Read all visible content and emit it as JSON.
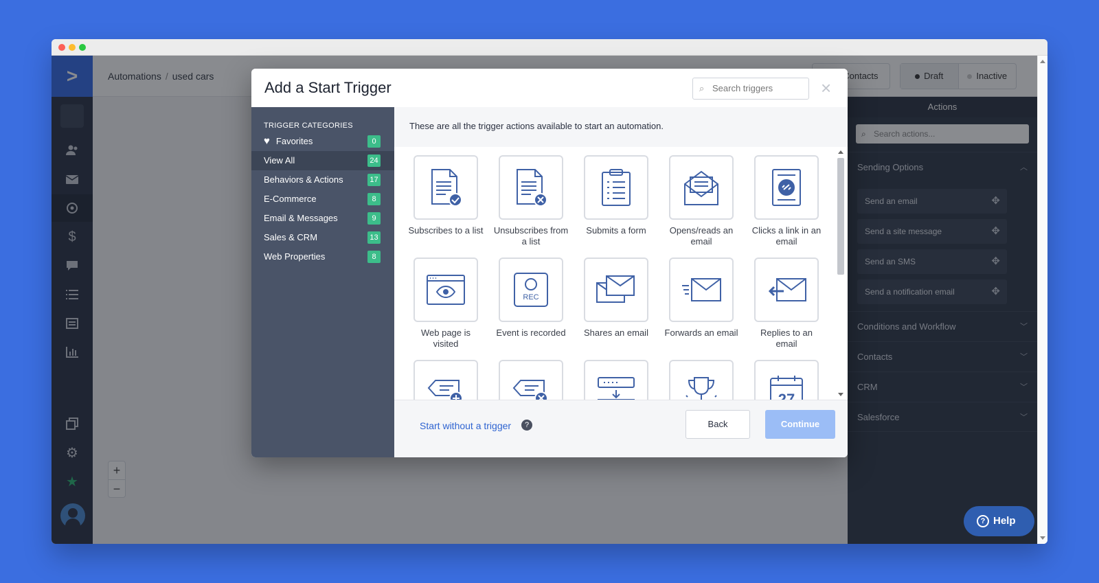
{
  "breadcrumb": {
    "root": "Automations",
    "separator": "/",
    "current": "used cars"
  },
  "header": {
    "view_contacts_label": "ew Contacts",
    "status_draft": "Draft",
    "status_inactive": "Inactive"
  },
  "nav": {
    "logo": ">",
    "items": [
      "search-icon",
      "contacts-icon",
      "campaigns-icon",
      "automations-icon",
      "deals-icon",
      "conversations-icon",
      "lists-icon",
      "forms-icon",
      "reports-icon",
      "pages-icon",
      "settings-icon",
      "star-icon"
    ]
  },
  "zoom": {
    "in": "+",
    "out": "−"
  },
  "actions_panel": {
    "title": "Actions",
    "search_placeholder": "Search actions...",
    "sections": [
      {
        "label": "Sending Options",
        "expanded": true
      },
      {
        "label": "Conditions and Workflow"
      },
      {
        "label": "Contacts"
      },
      {
        "label": "CRM"
      },
      {
        "label": "Salesforce"
      }
    ],
    "sending_items": [
      "Send an email",
      "Send a site message",
      "Send an SMS",
      "Send a notification email"
    ]
  },
  "help": {
    "label": "Help",
    "icon": "?"
  },
  "modal": {
    "title": "Add a Start Trigger",
    "search_placeholder": "Search triggers",
    "close": "×",
    "categories_title": "TRIGGER CATEGORIES",
    "categories": [
      {
        "label": "Favorites",
        "count": "0"
      },
      {
        "label": "View All",
        "count": "24",
        "active": true
      },
      {
        "label": "Behaviors & Actions",
        "count": "17"
      },
      {
        "label": "E-Commerce",
        "count": "8"
      },
      {
        "label": "Email & Messages",
        "count": "9"
      },
      {
        "label": "Sales & CRM",
        "count": "13"
      },
      {
        "label": "Web Properties",
        "count": "8"
      }
    ],
    "intro": "These are all the trigger actions available to start an automation.",
    "triggers": [
      {
        "label": "Subscribes to a list",
        "icon": "subscribe-icon"
      },
      {
        "label": "Unsubscribes from a list",
        "icon": "unsubscribe-icon"
      },
      {
        "label": "Submits a form",
        "icon": "form-icon"
      },
      {
        "label": "Opens/reads an email",
        "icon": "open-email-icon"
      },
      {
        "label": "Clicks a link in an email",
        "icon": "link-click-icon"
      },
      {
        "label": "Web page is visited",
        "icon": "web-page-icon"
      },
      {
        "label": "Event is recorded",
        "icon": "event-recorded-icon"
      },
      {
        "label": "Shares an email",
        "icon": "share-email-icon"
      },
      {
        "label": "Forwards an email",
        "icon": "forward-email-icon"
      },
      {
        "label": "Replies to an email",
        "icon": "reply-email-icon"
      },
      {
        "label": "",
        "icon": "tag-added-icon"
      },
      {
        "label": "",
        "icon": "tag-removed-icon"
      },
      {
        "label": "",
        "icon": "field-changed-icon"
      },
      {
        "label": "",
        "icon": "goal-trophy-icon"
      },
      {
        "label": "",
        "icon": "calendar-icon",
        "text": "27"
      }
    ],
    "start_without": "Start without a trigger",
    "help_mark": "?",
    "back": "Back",
    "continue": "Continue"
  }
}
